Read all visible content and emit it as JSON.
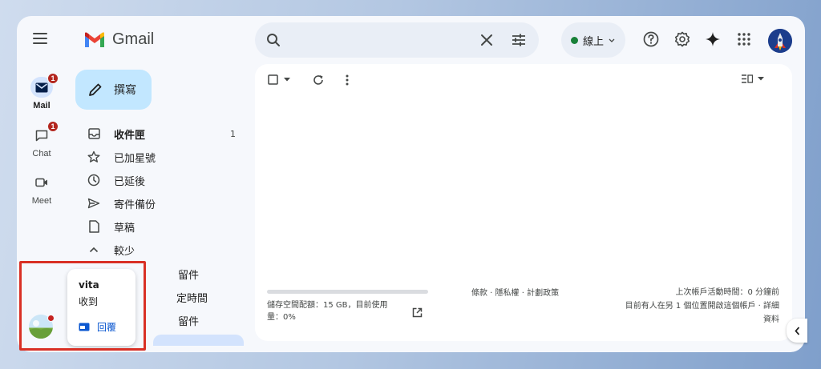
{
  "app": {
    "name": "Gmail"
  },
  "rail": {
    "items": [
      {
        "label": "Mail",
        "badge": "1",
        "active": true
      },
      {
        "label": "Chat",
        "badge": "1",
        "active": false
      },
      {
        "label": "Meet",
        "badge": "",
        "active": false
      }
    ]
  },
  "compose": {
    "label": "撰寫"
  },
  "nav": {
    "inbox": {
      "label": "收件匣",
      "count": "1"
    },
    "starred": {
      "label": "已加星號"
    },
    "snoozed": {
      "label": "已延後"
    },
    "sent": {
      "label": "寄件備份"
    },
    "drafts": {
      "label": "草稿"
    },
    "less": {
      "label": "較少"
    },
    "partial": [
      "留件",
      "定時間",
      "留件"
    ]
  },
  "status": {
    "label": "線上"
  },
  "storage": {
    "text": "儲存空間配額：15 GB，目前使用量：0%",
    "fill": 0.0
  },
  "footer": {
    "terms": "條款 · 隱私權 · 計劃政策",
    "last_activity": "上次帳戶活動時間：0 分鐘前",
    "other_sessions": "目前有人在另 1 個位置開啟這個帳戶 · 詳細",
    "details": "資料"
  },
  "chat_popup": {
    "name": "vita",
    "subtitle": "收到",
    "reply_label": "回覆"
  },
  "colors": {
    "accent": "#0b57d0",
    "compose": "#c2e7ff",
    "badge": "#b3261e",
    "online": "#188038",
    "highlight": "#d93025"
  }
}
